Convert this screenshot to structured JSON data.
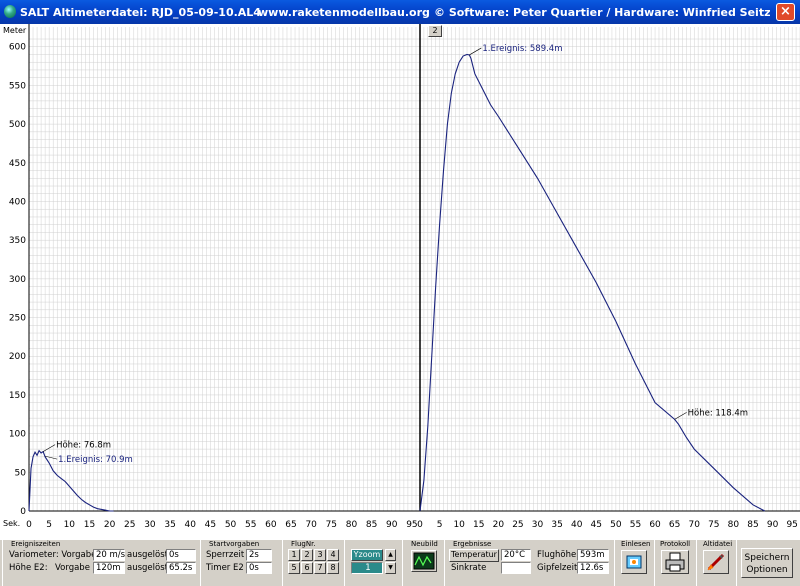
{
  "window": {
    "title_left": "SALT Altimeterdatei: RJD_05-09-10.AL4",
    "title_mid": "www.raketenmodellbau.org",
    "title_right": "© Software: Peter Quartier / Hardware: Winfried Seitz",
    "close_label": "×"
  },
  "plot": {
    "y_axis_label": "Meter",
    "x_axis_label": "Sek.",
    "panel_marker": "2",
    "colors": {
      "curve": "#1a237e",
      "grid": "#d0d0d0",
      "axis": "#000000"
    }
  },
  "chart_data": [
    {
      "type": "line",
      "name_marker": "",
      "x": [
        0,
        0.5,
        1,
        1.5,
        2,
        2.5,
        3,
        3.5,
        4,
        5,
        6,
        7,
        8,
        9,
        10,
        11,
        12,
        13,
        14,
        15,
        16,
        17,
        18,
        19,
        20,
        21
      ],
      "y": [
        0,
        55,
        70,
        76,
        72,
        78,
        75,
        76.8,
        70,
        62,
        52,
        46,
        42,
        38,
        32,
        26,
        20,
        15,
        11,
        8,
        5,
        3,
        2,
        1,
        0,
        0
      ],
      "xlim": [
        0,
        97
      ],
      "ylim": [
        0,
        610
      ],
      "annotations": [
        {
          "text": "Höhe: 76.8m",
          "x": 3.5,
          "y": 76.8
        },
        {
          "text": "1.Ereignis: 70.9m",
          "x": 4,
          "y": 70.9
        }
      ]
    },
    {
      "type": "line",
      "x": [
        0,
        1,
        2,
        3,
        4,
        5,
        6,
        7,
        8,
        9,
        10,
        11,
        12,
        12.6,
        13,
        14,
        16,
        18,
        20,
        25,
        30,
        35,
        40,
        45,
        50,
        55,
        60,
        65,
        66,
        68,
        70,
        75,
        80,
        85,
        88
      ],
      "y": [
        0,
        40,
        110,
        200,
        290,
        370,
        440,
        500,
        540,
        565,
        580,
        588,
        590,
        589.4,
        585,
        565,
        545,
        525,
        510,
        470,
        430,
        385,
        340,
        295,
        245,
        190,
        140,
        118.4,
        112,
        95,
        80,
        55,
        30,
        8,
        0
      ],
      "xlim": [
        0,
        97
      ],
      "ylim": [
        0,
        610
      ],
      "annotations": [
        {
          "text": "1.Ereignis: 589.4m",
          "x": 12.6,
          "y": 589.4
        },
        {
          "text": "Höhe: 118.4m",
          "x": 65,
          "y": 118.4
        }
      ]
    }
  ],
  "y_ticks": [
    0,
    50,
    100,
    150,
    200,
    250,
    300,
    350,
    400,
    450,
    500,
    550,
    600
  ],
  "x_ticks": [
    0,
    5,
    10,
    15,
    20,
    25,
    30,
    35,
    40,
    45,
    50,
    55,
    60,
    65,
    70,
    75,
    80,
    85,
    90,
    95
  ],
  "bottom": {
    "ereignis": {
      "title": "Ereigniszeiten",
      "r1_label": "Variometer: Vorgabe",
      "r1_val": "20 m/s",
      "r1_label2": "ausgelöst",
      "r1_val2": "0s",
      "r2_label": "Höhe E2:",
      "r2_label_b": "Vorgabe",
      "r2_val": "120m",
      "r2_label2": "ausgelöst",
      "r2_val2": "65.2s"
    },
    "start": {
      "title": "Startvorgaben",
      "sperr_label": "Sperrzeit",
      "sperr_val": "2s",
      "timer_label": "Timer E2",
      "timer_val": "0s"
    },
    "flug": {
      "title": "FlugNr.",
      "nums": [
        "1",
        "2",
        "3",
        "4",
        "5",
        "6",
        "7",
        "8"
      ]
    },
    "yzoom": {
      "label": "Yzoom",
      "value": "1",
      "up": "▲",
      "down": "▼"
    },
    "neubild": {
      "title": "Neubild"
    },
    "ergebnisse": {
      "title": "Ergebnisse",
      "temp_label": "Temperatur",
      "temp_val": "20°C",
      "sink_label": "Sinkrate",
      "sink_val": "",
      "hoehe_label": "Flughöhe",
      "hoehe_val": "593m",
      "gipfel_label": "Gipfelzeit",
      "gipfel_val": "12.6s"
    },
    "einlesen": {
      "title": "Einlesen"
    },
    "protokoll": {
      "title": "Protokoll"
    },
    "altidatei": {
      "title": "Altidatei"
    },
    "speichern": {
      "label1": "Speichern",
      "label2": "Optionen"
    }
  }
}
